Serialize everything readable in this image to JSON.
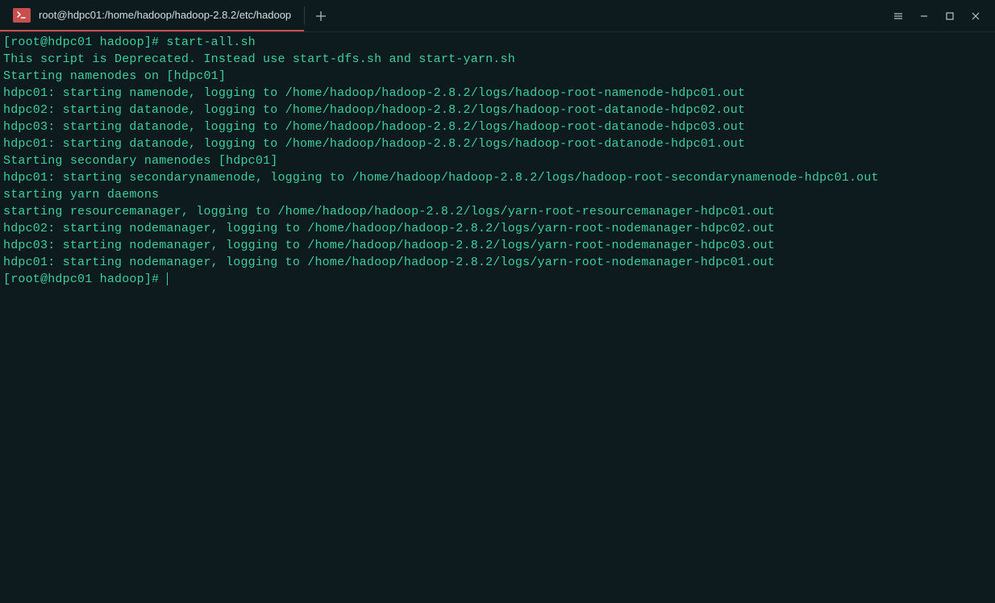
{
  "titlebar": {
    "tab_title": "root@hdpc01:/home/hadoop/hadoop-2.8.2/etc/hadoop"
  },
  "terminal": {
    "lines": [
      "[root@hdpc01 hadoop]# start-all.sh",
      "This script is Deprecated. Instead use start-dfs.sh and start-yarn.sh",
      "Starting namenodes on [hdpc01]",
      "hdpc01: starting namenode, logging to /home/hadoop/hadoop-2.8.2/logs/hadoop-root-namenode-hdpc01.out",
      "hdpc02: starting datanode, logging to /home/hadoop/hadoop-2.8.2/logs/hadoop-root-datanode-hdpc02.out",
      "hdpc03: starting datanode, logging to /home/hadoop/hadoop-2.8.2/logs/hadoop-root-datanode-hdpc03.out",
      "hdpc01: starting datanode, logging to /home/hadoop/hadoop-2.8.2/logs/hadoop-root-datanode-hdpc01.out",
      "Starting secondary namenodes [hdpc01]",
      "hdpc01: starting secondarynamenode, logging to /home/hadoop/hadoop-2.8.2/logs/hadoop-root-secondarynamenode-hdpc01.out",
      "starting yarn daemons",
      "starting resourcemanager, logging to /home/hadoop/hadoop-2.8.2/logs/yarn-root-resourcemanager-hdpc01.out",
      "hdpc02: starting nodemanager, logging to /home/hadoop/hadoop-2.8.2/logs/yarn-root-nodemanager-hdpc02.out",
      "hdpc03: starting nodemanager, logging to /home/hadoop/hadoop-2.8.2/logs/yarn-root-nodemanager-hdpc03.out",
      "hdpc01: starting nodemanager, logging to /home/hadoop/hadoop-2.8.2/logs/yarn-root-nodemanager-hdpc01.out"
    ],
    "prompt": "[root@hdpc01 hadoop]# "
  },
  "colors": {
    "background": "#0d1b1e",
    "text": "#3fcf9e",
    "accent": "#c94f4f",
    "ui_text": "#d6dee0"
  }
}
